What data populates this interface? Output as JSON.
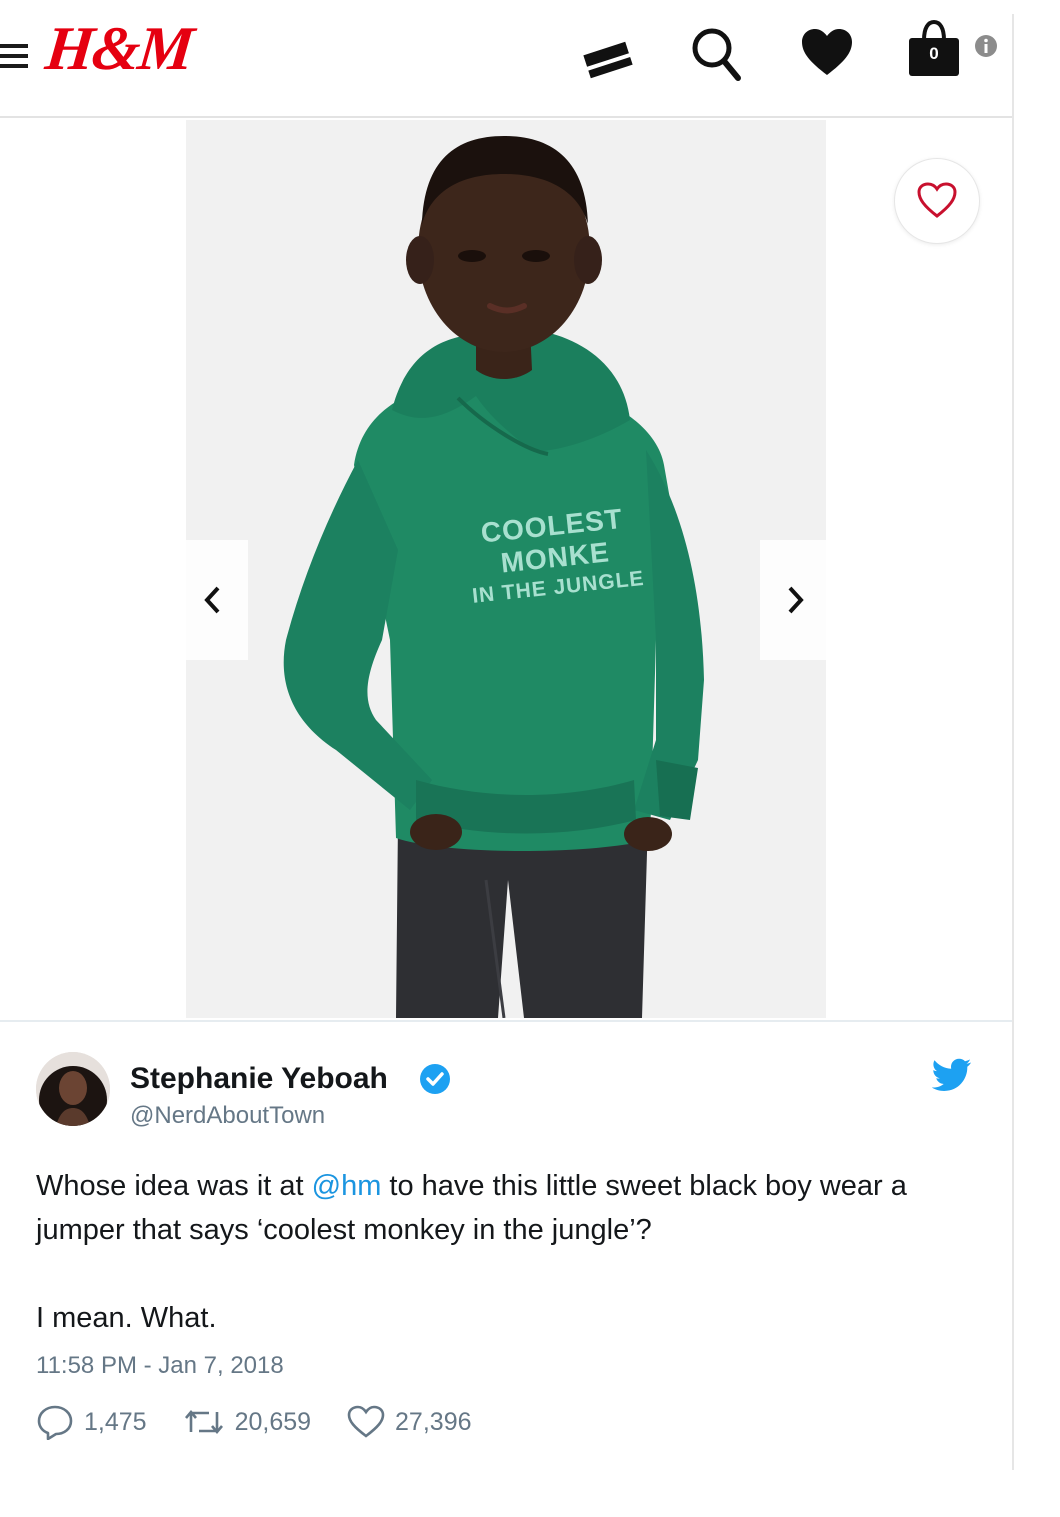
{
  "header": {
    "brand": "H&M",
    "bag_count": "0",
    "icons": [
      "menu-icon",
      "card-icon",
      "search-icon",
      "heart-icon",
      "bag-icon",
      "info-icon"
    ]
  },
  "product": {
    "print_line1": "COOLEST MONKE",
    "print_line2": "IN THE JUNGLE",
    "prev_arrow": "‹",
    "next_arrow": "›"
  },
  "tweet": {
    "name": "Stephanie Yeboah",
    "handle": "@NerdAboutTown",
    "text_part1": "Whose idea was it at ",
    "mention": "@hm",
    "text_part2": " to have this little sweet black boy wear a jumper that says ‘coolest monkey in the jungle’?",
    "text_line2": "I mean. What.",
    "timestamp": "11:58 PM - Jan 7, 2018",
    "replies": "1,475",
    "retweets": "20,659",
    "likes": "27,396",
    "colors": {
      "link": "#1b95e0",
      "muted": "#657786",
      "verified": "#1da1f2"
    }
  }
}
